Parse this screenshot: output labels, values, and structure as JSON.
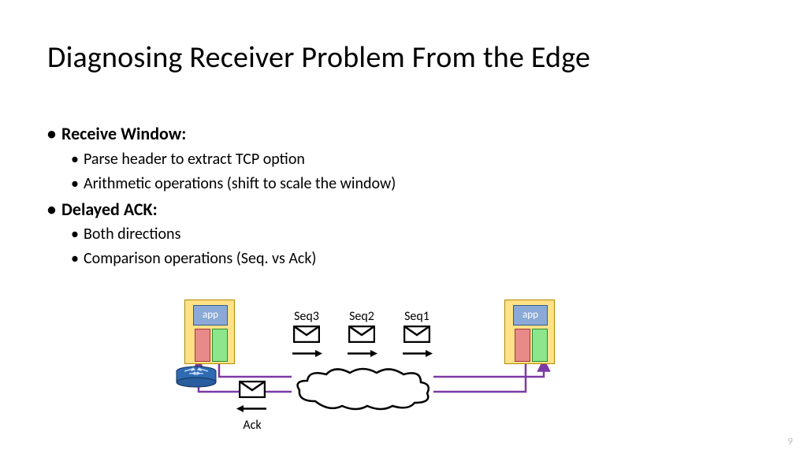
{
  "title": "Diagnosing Receiver Problem From the Edge",
  "bullets": {
    "rwnd": {
      "title": "Receive Window:",
      "items": [
        "Parse header to extract TCP option",
        "Arithmetic operations (shift to scale the window)"
      ]
    },
    "dack": {
      "title": "Delayed ACK:",
      "items": [
        "Both directions",
        "Comparison operations (Seq. vs Ack)"
      ]
    }
  },
  "diagram": {
    "app_label": "app",
    "seq": [
      "Seq3",
      "Seq2",
      "Seq1"
    ],
    "ack": "Ack"
  },
  "slide_number": "9"
}
